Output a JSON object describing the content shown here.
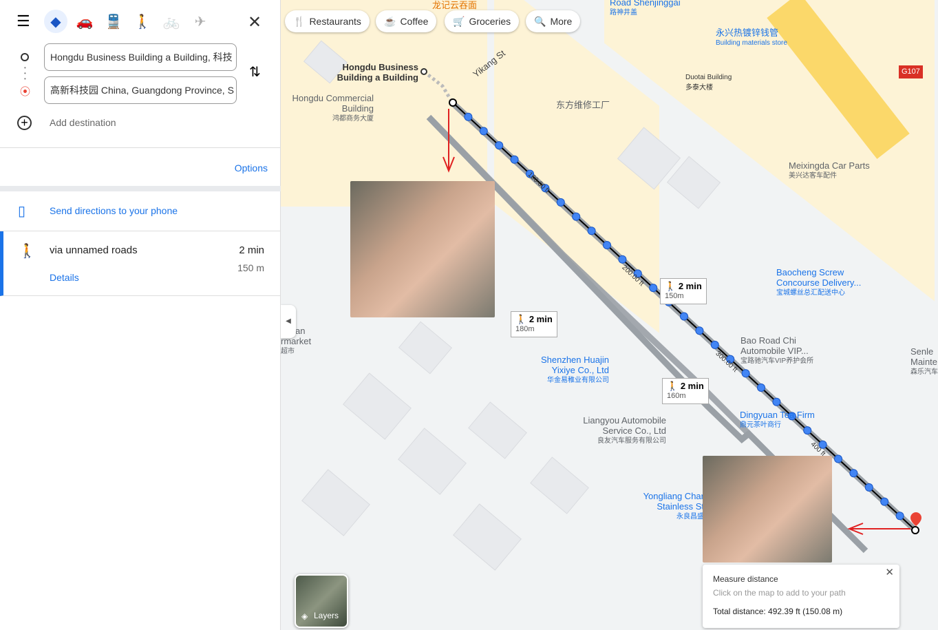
{
  "sidebar": {
    "modes": [
      "directions-icon",
      "car-icon",
      "transit-icon",
      "walk-icon",
      "bike-icon",
      "flight-icon"
    ],
    "origin": "Hongdu Business Building a Building, 科技",
    "destination": "高新科技园 China, Guangdong Province, S",
    "add_destination": "Add destination",
    "options": "Options",
    "send_to_phone": "Send directions to your phone",
    "route": {
      "via": "via unnamed roads",
      "time": "2 min",
      "distance": "150 m",
      "details": "Details"
    }
  },
  "map": {
    "chips": [
      "Restaurants",
      "Coffee",
      "Groceries",
      "More"
    ],
    "labels": [
      {
        "t": "Hongdu Business Building a Building",
        "s": ""
      },
      {
        "t": "Hongdu Commercial Building",
        "s": "鸿都商务大厦"
      },
      {
        "t": "Yikang St",
        "s": ""
      },
      {
        "t": "东方维修工厂",
        "s": ""
      },
      {
        "t": "永兴热镀锌钱管",
        "s": "Building materials store"
      },
      {
        "t": "Duotai Building",
        "s": "多泰大楼"
      },
      {
        "t": "Meixingda Car Parts",
        "s": "美兴达客车配件"
      },
      {
        "t": "Baocheng Screw Concourse Delivery...",
        "s": "宝城螺丝总汇配送中心"
      },
      {
        "t": "Bao Road Chi Automobile VIP...",
        "s": "宝路驰汽车VIP养护会所"
      },
      {
        "t": "Shenzhen Huajin Yixiye Co., Ltd",
        "s": "华金易稚业有限公司"
      },
      {
        "t": "Liangyou Automobile Service Co., Ltd",
        "s": "良友汽车服务有限公司"
      },
      {
        "t": "Dingyuan Tea Firm",
        "s": "鼎元茶叶商行"
      },
      {
        "t": "Yongliang Char Stainless St",
        "s": "永良昌盛"
      },
      {
        "t": "Road Shenjinggai",
        "s": "路神井盖"
      },
      {
        "t": "龙记云吞面",
        "s": ""
      },
      {
        "t": "G107",
        "s": ""
      },
      {
        "t": "gyuan rmarket",
        "s": "超市"
      },
      {
        "t": "Senle Mainte",
        "s": "森乐汽车"
      }
    ],
    "walk_boxes": [
      {
        "time": "2 min",
        "dist": "150m"
      },
      {
        "time": "2 min",
        "dist": "180m"
      },
      {
        "time": "2 min",
        "dist": "160m"
      }
    ],
    "scale_marks": [
      "100.00 ft",
      "200.00 ft",
      "300.00 ft",
      "400 ft"
    ],
    "measure": {
      "title": "Measure distance",
      "hint": "Click on the map to add to your path",
      "total": "Total distance: 492.39 ft (150.08 m)"
    },
    "layers": "Layers"
  },
  "colors": {
    "accent": "#1a73e8",
    "measure_dot": "#4285f4",
    "arrow": "#e02020",
    "pin": "#ea4335"
  }
}
